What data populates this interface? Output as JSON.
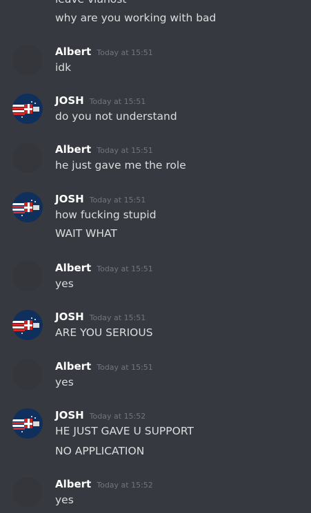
{
  "top": {
    "partial_line": "leave vianost",
    "line": "why are you working with bad"
  },
  "messages": [
    {
      "author": "Albert",
      "time": "Today at 15:51",
      "avatar": "blank",
      "lines": [
        "idk"
      ]
    },
    {
      "author": "JOSH",
      "time": "Today at 15:51",
      "avatar": "flag-avatar",
      "lines": [
        "do you not understand"
      ]
    },
    {
      "author": "Albert",
      "time": "Today at 15:51",
      "avatar": "blank",
      "lines": [
        "he just gave me the role"
      ]
    },
    {
      "author": "JOSH",
      "time": "Today at 15:51",
      "avatar": "flag-avatar",
      "lines": [
        "how fucking stupid",
        "WAIT WHAT"
      ]
    },
    {
      "author": "Albert",
      "time": "Today at 15:51",
      "avatar": "blank",
      "lines": [
        "yes"
      ]
    },
    {
      "author": "JOSH",
      "time": "Today at 15:51",
      "avatar": "flag-avatar",
      "lines": [
        "ARE YOU SERIOUS"
      ]
    },
    {
      "author": "Albert",
      "time": "Today at 15:51",
      "avatar": "blank",
      "lines": [
        "yes"
      ]
    },
    {
      "author": "JOSH",
      "time": "Today at 15:52",
      "avatar": "flag-avatar",
      "lines": [
        "HE JUST GAVE U SUPPORT",
        "NO APPLICATION"
      ]
    },
    {
      "author": "Albert",
      "time": "Today at 15:52",
      "avatar": "blank",
      "lines": [
        "yes"
      ]
    }
  ],
  "colors": {
    "background": "#36393f",
    "author": "#ffffff",
    "text": "#dcddde",
    "timestamp": "#72767d"
  }
}
